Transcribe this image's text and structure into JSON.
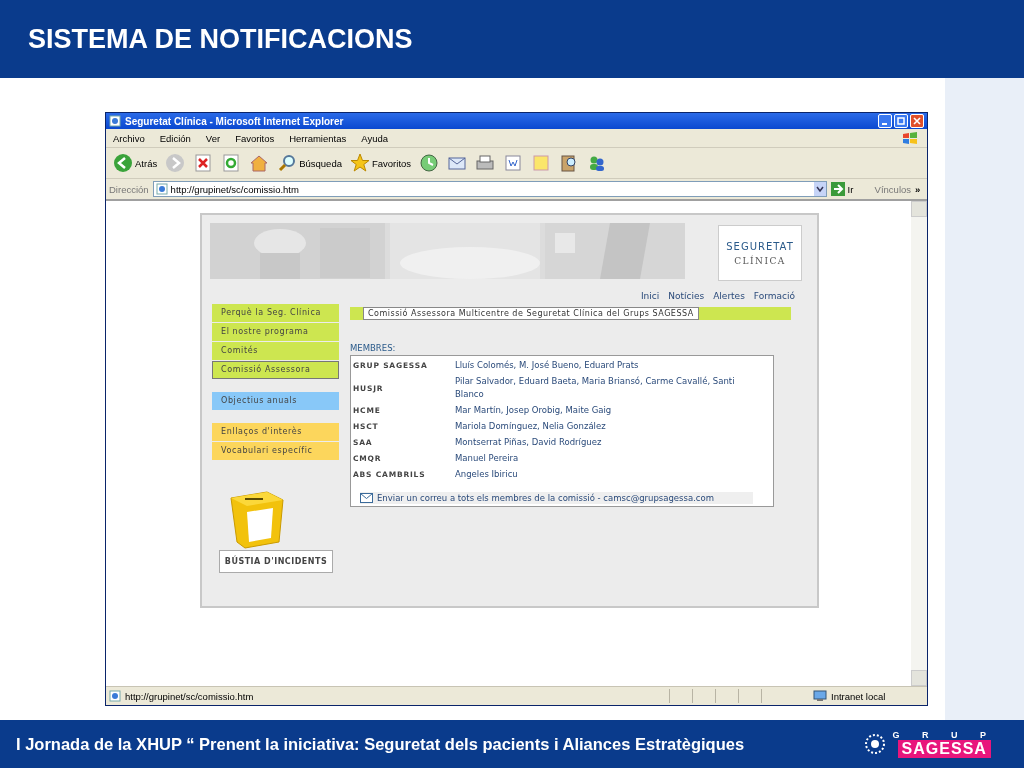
{
  "slide_title": "SISTEMA DE NOTIFICACIONS",
  "browser": {
    "title": "Seguretat Clínica - Microsoft Internet Explorer",
    "menu": [
      "Archivo",
      "Edición",
      "Ver",
      "Favoritos",
      "Herramientas",
      "Ayuda"
    ],
    "toolbar": [
      {
        "kind": "back",
        "label": "Atrás"
      },
      {
        "kind": "forward"
      },
      {
        "kind": "stop"
      },
      {
        "kind": "refresh"
      },
      {
        "kind": "home"
      },
      {
        "kind": "search",
        "label": "Búsqueda"
      },
      {
        "kind": "favorites",
        "label": "Favoritos"
      },
      {
        "kind": "history"
      },
      {
        "kind": "mail"
      },
      {
        "kind": "print"
      },
      {
        "kind": "word"
      },
      {
        "kind": "note"
      },
      {
        "kind": "research"
      },
      {
        "kind": "messenger"
      }
    ],
    "address_label": "Dirección",
    "address": "http://grupinet/sc/comissio.htm",
    "go": "Ir",
    "links": "Vínculos",
    "links_more": "»",
    "status_url": "http://grupinet/sc/comissio.htm",
    "zone": "Intranet local"
  },
  "page": {
    "logo": [
      "SEGURETAT",
      "CLÍNICA"
    ],
    "top_nav": [
      "Inici",
      "Notícies",
      "Alertes",
      "Formació"
    ],
    "nav_groups": [
      [
        {
          "label": "Perquè la Seg. Clínica",
          "color": "#cde650",
          "selected": false
        },
        {
          "label": "El nostre programa",
          "color": "#cde650",
          "selected": false
        },
        {
          "label": "Comités",
          "color": "#cde650",
          "selected": false
        },
        {
          "label": "Comissió Assessora",
          "color": "#cde650",
          "selected": true
        }
      ],
      [
        {
          "label": "Objectius anuals",
          "color": "#88c8f8",
          "selected": false
        }
      ],
      [
        {
          "label": "Enllaços d'interès",
          "color": "#fcd65c",
          "selected": false
        },
        {
          "label": "Vocabulari específic",
          "color": "#fcd65c",
          "selected": false
        }
      ]
    ],
    "mailbox_button": "BÚSTIA D'INCIDENTS",
    "heading": "Comissió Assessora Multicentre de Seguretat Clínica del Grups SAGESSA",
    "members_label": "MEMBRES:",
    "members": [
      {
        "center": "GRUP SAGESSA",
        "names": "Lluís Colomés, M. José Bueno, Eduard Prats"
      },
      {
        "center": "HUSJR",
        "names": "Pilar Salvador, Eduard Baeta, Maria Briansó, Carme Cavallé, Santi Blanco"
      },
      {
        "center": "HCME",
        "names": "Mar Martín, Josep Orobig, Maite Gaig"
      },
      {
        "center": "HSCT",
        "names": "Mariola Domínguez, Nelia González"
      },
      {
        "center": "SAA",
        "names": "Montserrat Piñas, David Rodríguez"
      },
      {
        "center": "CMQR",
        "names": "Manuel Pereira"
      },
      {
        "center": "ABS CAMBRILS",
        "names": "Angeles Ibiricu"
      }
    ],
    "mail_all": "Enviar un correu a tots els membres de la comissió - camsc@grupsagessa.com"
  },
  "footer": {
    "text": "I Jornada de la XHUP “ Prenent la iniciativa: Seguretat dels pacients i Aliances Estratègiques",
    "logo_top": "G R U P",
    "logo_name": "SAGESSA"
  }
}
